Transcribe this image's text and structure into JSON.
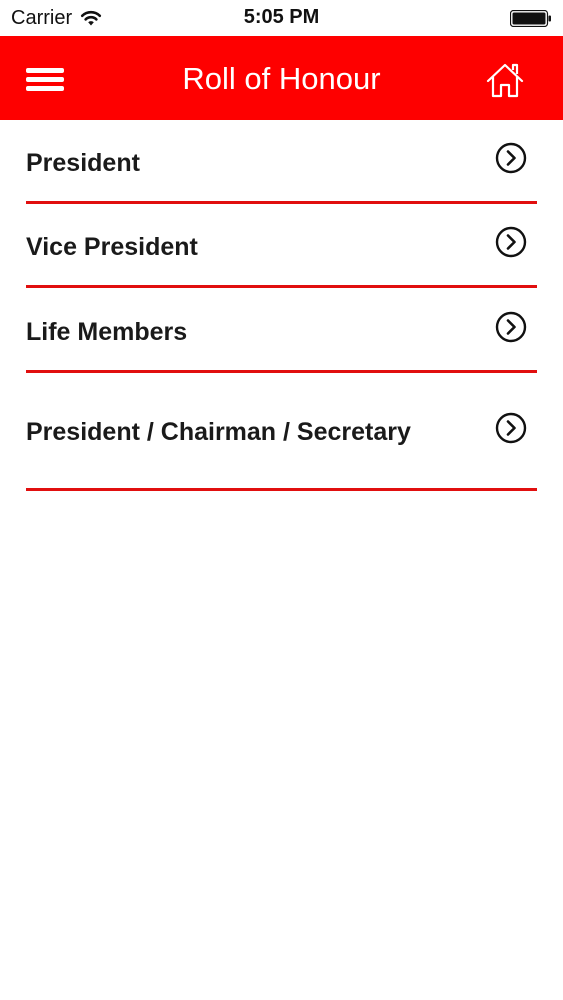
{
  "status_bar": {
    "carrier": "Carrier",
    "time": "5:05 PM",
    "wifi_icon": "wifi-icon",
    "battery_icon": "battery-icon"
  },
  "nav": {
    "title": "Roll of Honour",
    "menu_icon": "hamburger-menu-icon",
    "home_icon": "home-icon",
    "background_color": "#fe0000"
  },
  "list": {
    "items": [
      {
        "label": "President",
        "icon": "chevron-right-circle-icon"
      },
      {
        "label": "Vice President",
        "icon": "chevron-right-circle-icon"
      },
      {
        "label": "Life Members",
        "icon": "chevron-right-circle-icon"
      },
      {
        "label": "President / Chairman / Secretary",
        "icon": "chevron-right-circle-icon"
      }
    ],
    "divider_color": "#e10f0f"
  }
}
